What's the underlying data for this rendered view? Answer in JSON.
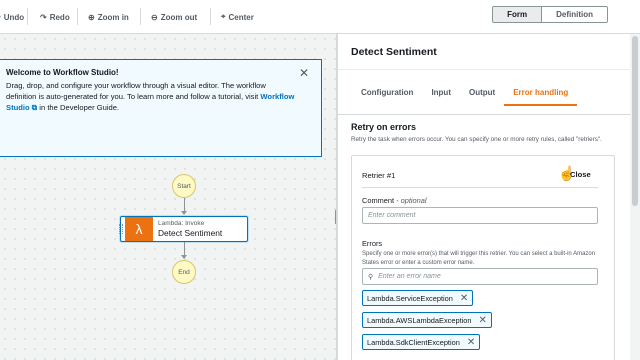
{
  "toolbar": {
    "undo": "Undo",
    "redo": "Redo",
    "zoom_in": "Zoom in",
    "zoom_out": "Zoom out",
    "center": "Center",
    "view_tabs": [
      "Form",
      "Definition"
    ],
    "active_view": "Form"
  },
  "welcome": {
    "title": "Welcome to Workflow Studio!",
    "body": "Drag, drop, and configure your workflow through a visual editor. The workflow definition is auto-generated for you. To learn more and follow a tutorial, visit",
    "link": "Workflow Studio",
    "suffix": "in the Developer Guide.",
    "close": "✕"
  },
  "graph": {
    "start": "Start",
    "end": "End",
    "task_type": "Lambda: Invoke",
    "task_name": "Detect Sentiment"
  },
  "panel": {
    "title": "Detect Sentiment",
    "tabs": [
      "Configuration",
      "Input",
      "Output",
      "Error handling"
    ],
    "active_tab": "Error handling",
    "section_title": "Retry on errors",
    "section_desc": "Retry the task when errors occur. You can specify one or more retry rules, called \"retriers\".",
    "retrier": {
      "label": "Retrier #1",
      "close": "Close",
      "comment_label": "Comment",
      "comment_optional": "- optional",
      "comment_placeholder": "Enter comment",
      "errors_label": "Errors",
      "errors_help": "Specify one or more error(s) that will trigger this retrier. You can select a built-in Amazon States error or enter a custom error name.",
      "errors_placeholder": "Enter an error name",
      "errors": [
        "Lambda.ServiceException",
        "Lambda.AWSLambdaException",
        "Lambda.SdkClientException"
      ]
    }
  },
  "colors": {
    "accent": "#ec7211",
    "link": "#0073bb"
  }
}
